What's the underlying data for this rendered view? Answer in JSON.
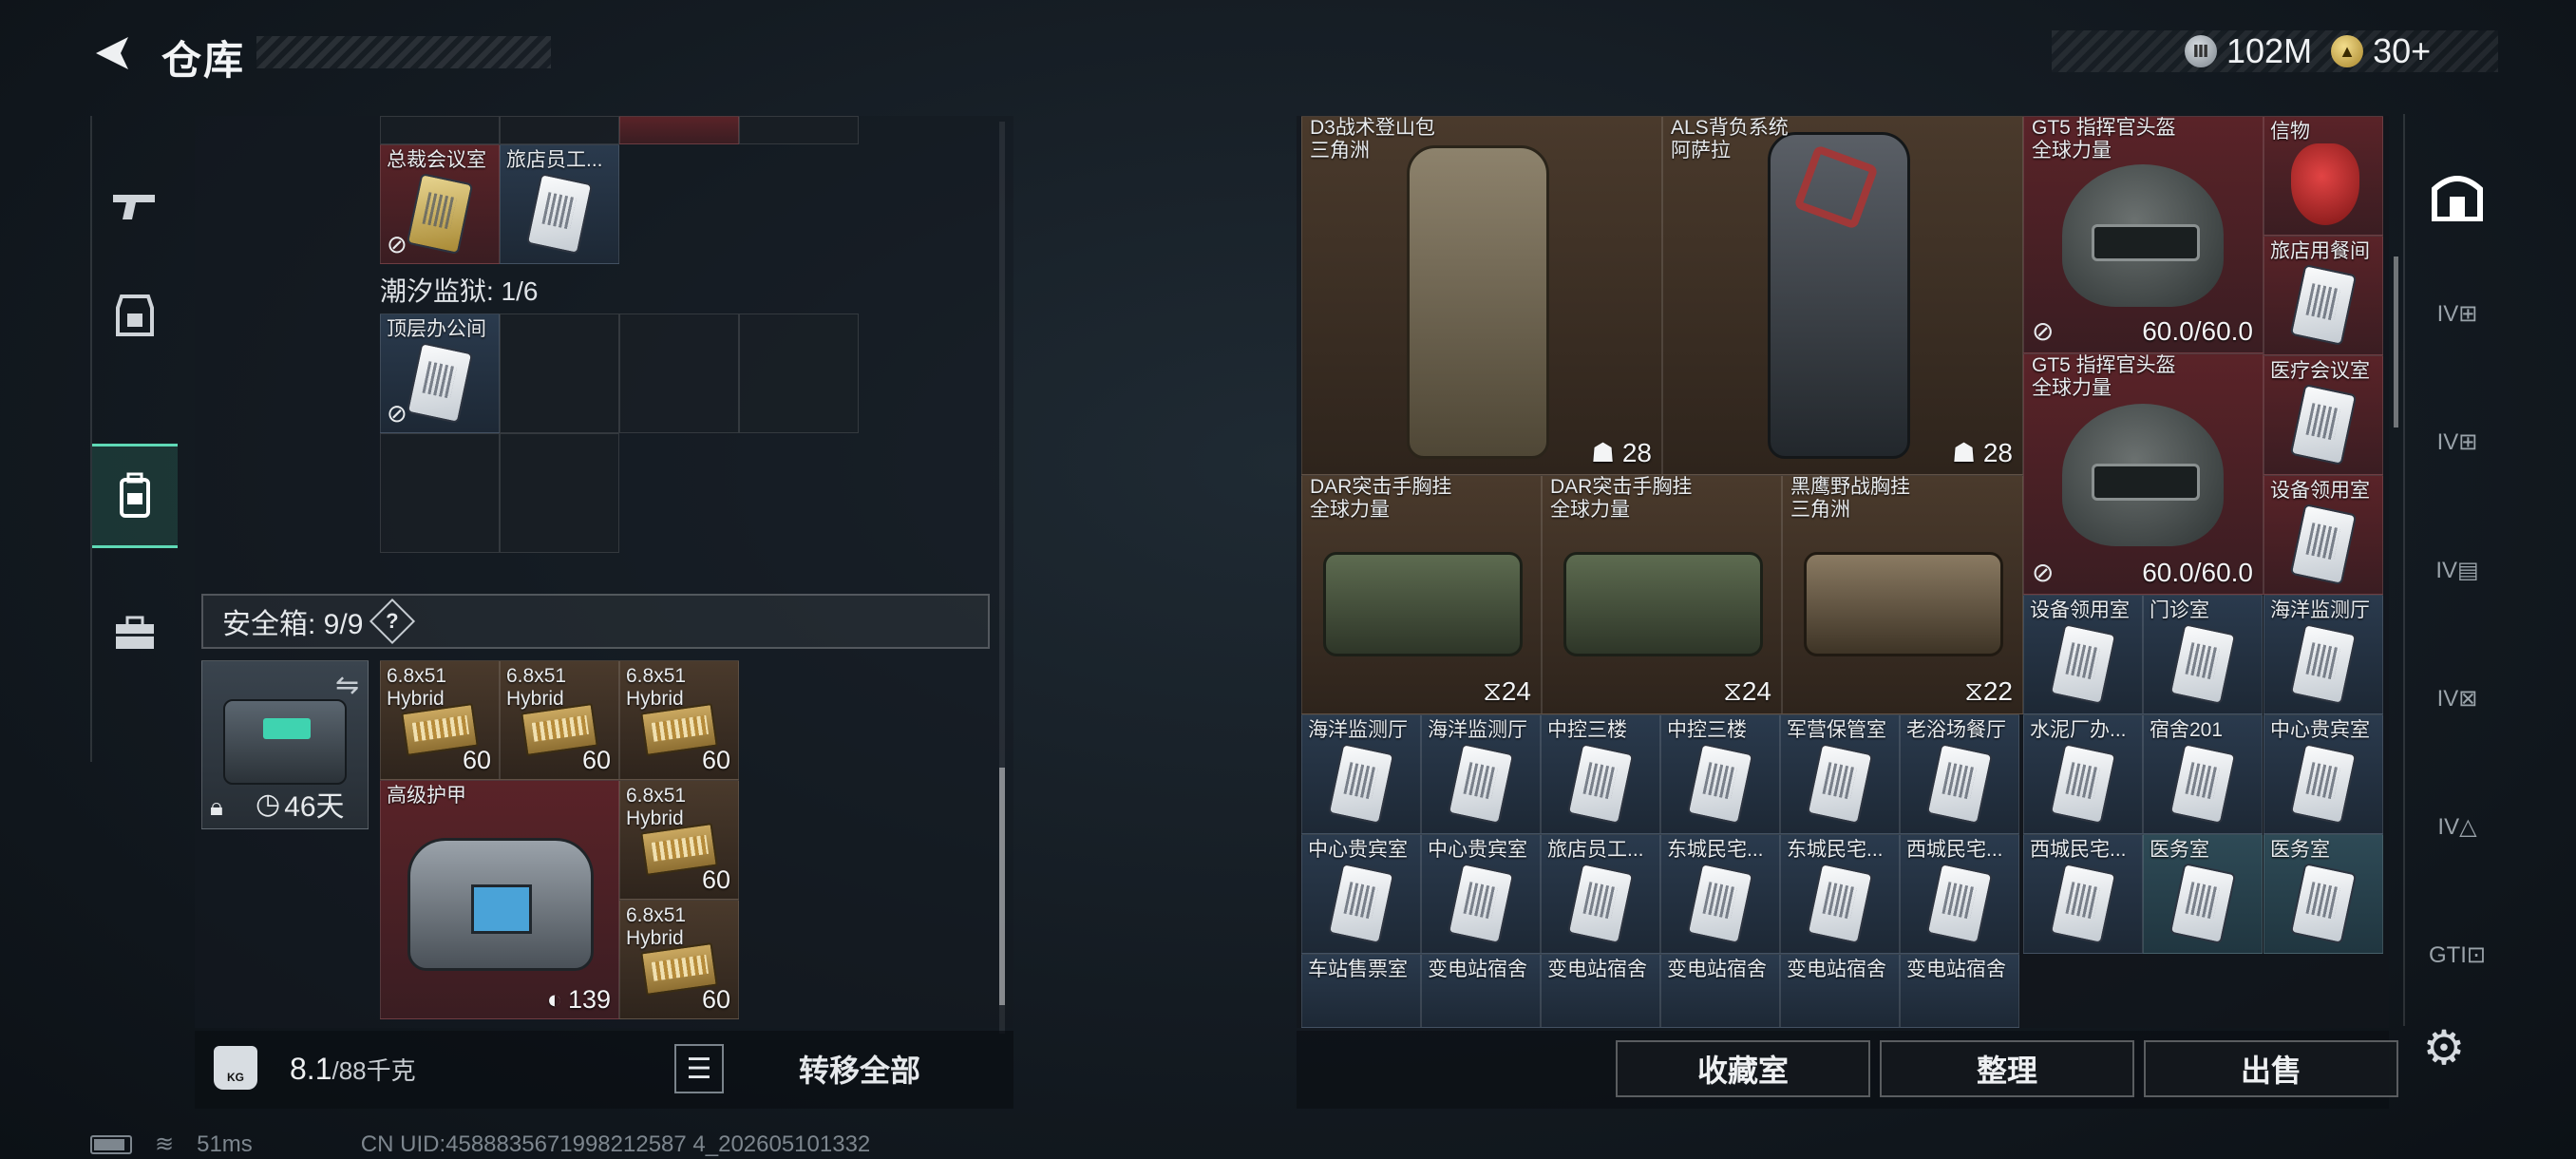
{
  "header": {
    "title": "仓库",
    "currencies": [
      {
        "icon": "silver-coin-icon",
        "value": "102M"
      },
      {
        "icon": "gold-coin-icon",
        "value": "30+"
      }
    ]
  },
  "left_rail": [
    {
      "icon": "gun-icon"
    },
    {
      "icon": "armor-icon"
    },
    {
      "icon": "backpack-icon",
      "active": true
    },
    {
      "icon": "toolbox-icon"
    }
  ],
  "left_panel": {
    "top_cards": [
      {
        "label": "总裁会议室"
      },
      {
        "label": "旅店员工..."
      }
    ],
    "section2_title": "潮汐监狱: 1/6",
    "section2_cards": [
      {
        "label": "顶层办公间"
      }
    ],
    "safe_box": {
      "title": "安全箱: 9/9",
      "help": "?",
      "duration": "46天",
      "items": {
        "ammo1": {
          "label1": "6.8x51",
          "label2": "Hybrid",
          "count": "60"
        },
        "ammo2": {
          "label1": "6.8x51",
          "label2": "Hybrid",
          "count": "60"
        },
        "ammo3": {
          "label1": "6.8x51",
          "label2": "Hybrid",
          "count": "60"
        },
        "ammo4": {
          "label1": "6.8x51",
          "label2": "Hybrid",
          "count": "60"
        },
        "ammo5": {
          "label1": "6.8x51",
          "label2": "Hybrid",
          "count": "60"
        },
        "armor": {
          "label": "高级护甲",
          "count": "139"
        }
      }
    },
    "weight": {
      "current": "8.1",
      "max": "/88千克",
      "icon_label": "KG"
    },
    "transfer_all": "转移全部"
  },
  "right_panel": {
    "backpacks": [
      {
        "label1": "D3战术登山包",
        "label2": "三角洲",
        "count": "28"
      },
      {
        "label1": "ALS背负系统",
        "label2": "阿萨拉",
        "count": "28"
      }
    ],
    "helmets": [
      {
        "label1": "GT5 指挥官头盔",
        "label2": "全球力量",
        "durability": "60.0/60.0"
      },
      {
        "label1": "GT5 指挥官头盔",
        "label2": "全球力量",
        "durability": "60.0/60.0"
      }
    ],
    "mask": {
      "label": "信物"
    },
    "vests": [
      {
        "label1": "DAR突击手胸挂",
        "label2": "全球力量",
        "count": "24"
      },
      {
        "label1": "DAR突击手胸挂",
        "label2": "全球力量",
        "count": "24"
      },
      {
        "label1": "黑鹰野战胸挂",
        "label2": "三角洲",
        "count": "22"
      }
    ],
    "side_cards": [
      "旅店用餐间",
      "医疗会议室",
      "设备领用室"
    ],
    "row_a": [
      "设备领用室",
      "门诊室",
      "海洋监测厅"
    ],
    "row_b": [
      "海洋监测厅",
      "海洋监测厅",
      "中控三楼",
      "中控三楼",
      "军营保管室",
      "老浴场餐厅",
      "水泥厂办...",
      "宿舍201",
      "中心贵宾室"
    ],
    "row_c": [
      "中心贵宾室",
      "中心贵宾室",
      "旅店员工...",
      "东城民宅...",
      "东城民宅...",
      "西城民宅...",
      "西城民宅...",
      "医务室",
      "医务室"
    ],
    "row_d": [
      "车站售票室",
      "变电站宿舍",
      "变电站宿舍",
      "变电站宿舍",
      "变电站宿舍",
      "变电站宿舍"
    ],
    "buttons": {
      "collection": "收藏室",
      "sort": "整理",
      "sell": "出售"
    }
  },
  "right_rail": [
    {
      "icon": "stash-icon",
      "active": true
    },
    {
      "icon": "storage-expand-1-icon",
      "label": "IV"
    },
    {
      "icon": "storage-expand-2-icon",
      "label": "IV"
    },
    {
      "icon": "storage-expand-3-icon",
      "label": "IV"
    },
    {
      "icon": "storage-expand-4-icon",
      "label": "IV"
    },
    {
      "icon": "storage-expand-5-icon",
      "label": "IV"
    },
    {
      "icon": "storage-expand-6-icon",
      "label": "GTI"
    }
  ],
  "status": {
    "ping": "51ms",
    "uid": "CN UID:4588835671998212587 4_202605101332"
  }
}
